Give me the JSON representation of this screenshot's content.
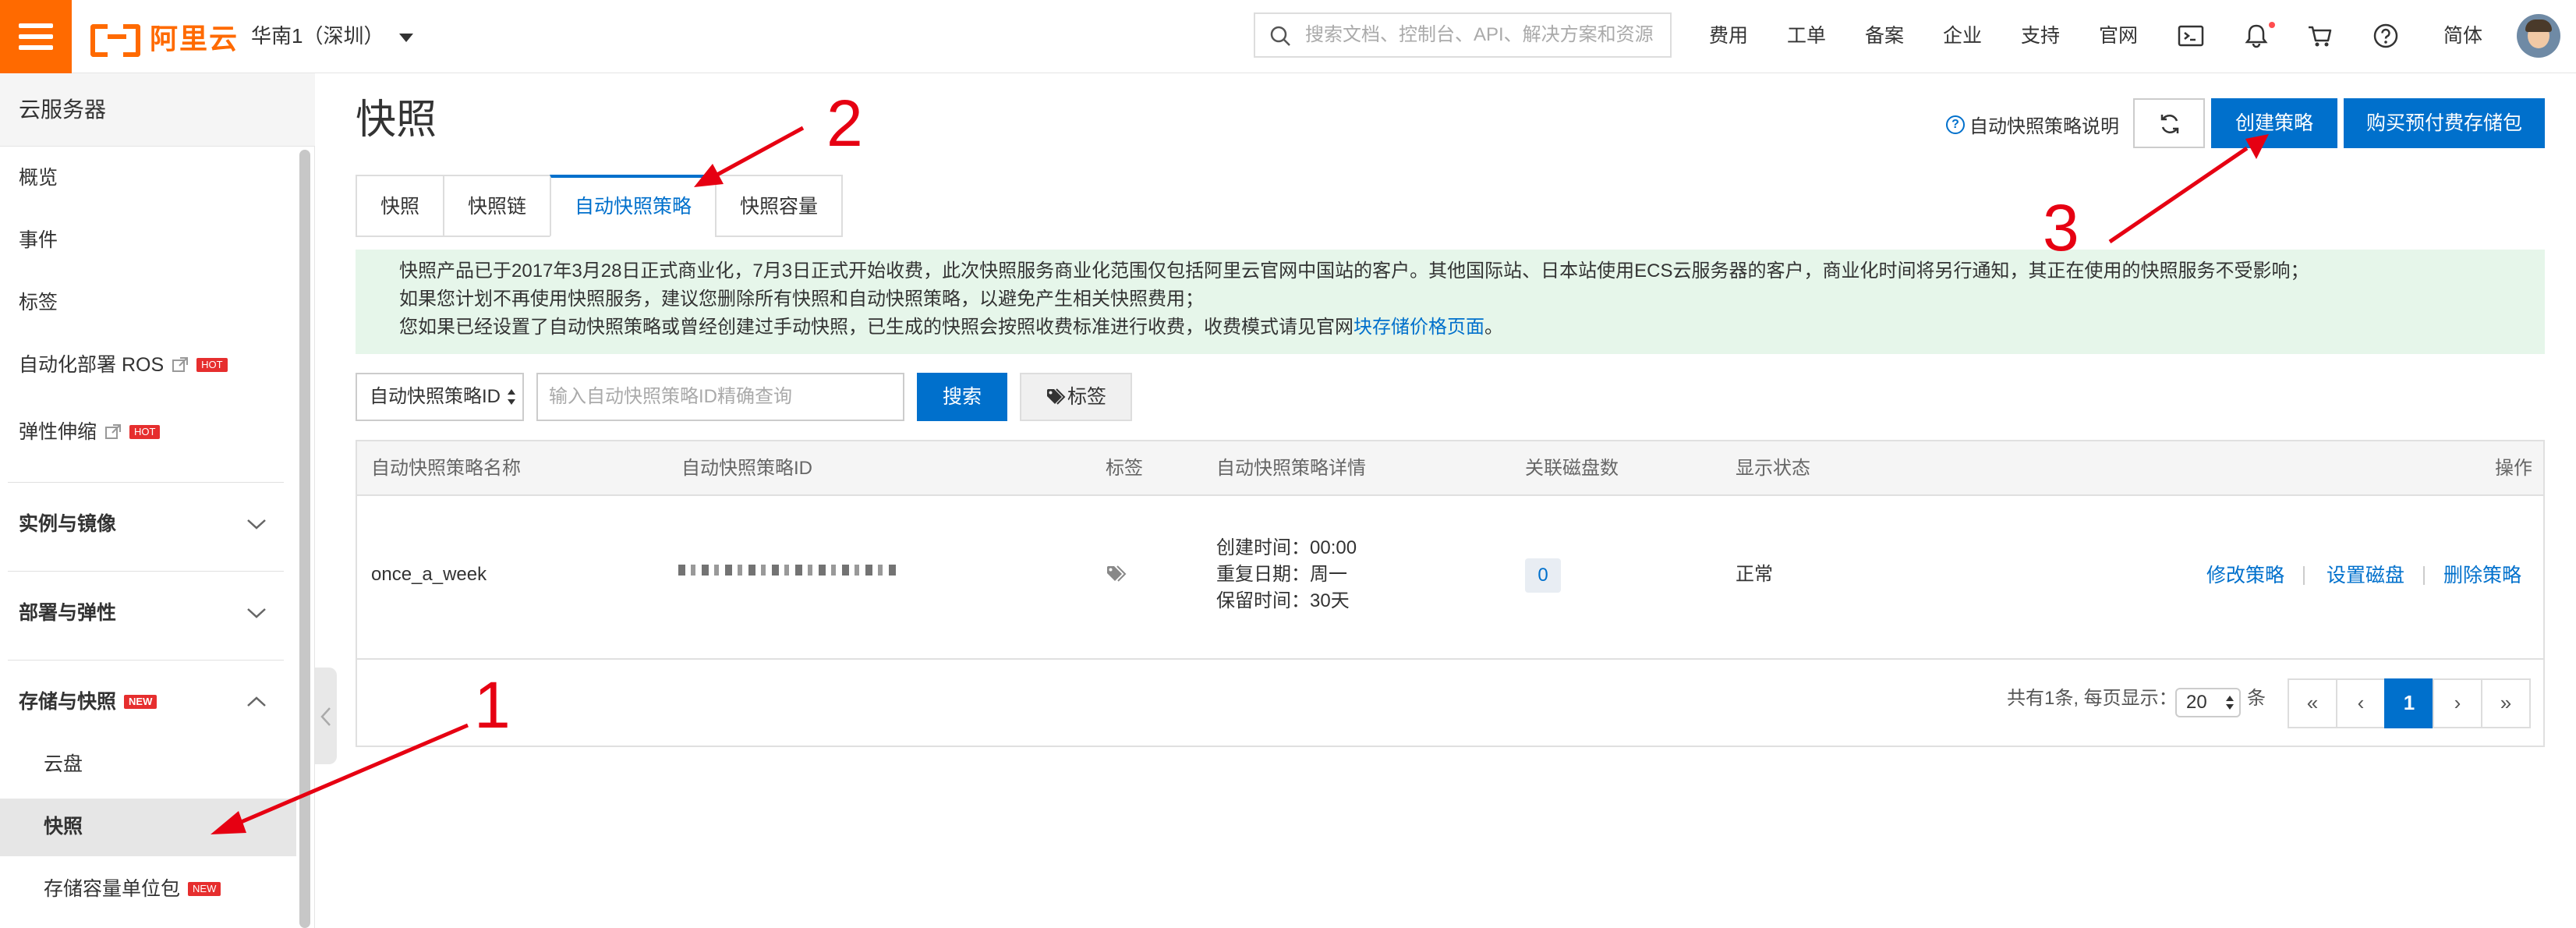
{
  "topbar": {
    "logo_text": "阿里云",
    "region": "华南1（深圳）",
    "search_placeholder": "搜索文档、控制台、API、解决方案和资源",
    "nav": [
      "费用",
      "工单",
      "备案",
      "企业",
      "支持",
      "官网"
    ],
    "language": "简体",
    "icons": [
      "terminal-icon",
      "bell-icon",
      "cart-icon",
      "help-icon"
    ]
  },
  "sidebar": {
    "title": "云服务器",
    "items": [
      {
        "label": "概览"
      },
      {
        "label": "事件"
      },
      {
        "label": "标签"
      },
      {
        "label": "自动化部署 ROS",
        "badge": "HOT"
      },
      {
        "label": "弹性伸缩",
        "badge": "HOT"
      }
    ],
    "groups": [
      {
        "label": "实例与镜像",
        "state": "collapsed"
      },
      {
        "label": "部署与弹性",
        "state": "collapsed"
      },
      {
        "label": "存储与快照",
        "badge": "NEW",
        "state": "expanded"
      }
    ],
    "sub_items": [
      {
        "label": "云盘"
      },
      {
        "label": "快照",
        "active": true
      },
      {
        "label": "存储容量单位包",
        "badge": "NEW"
      }
    ]
  },
  "main": {
    "title": "快照",
    "help_link": "自动快照策略说明",
    "create_button": "创建策略",
    "buy_button": "购买预付费存储包",
    "tabs": [
      {
        "label": "快照",
        "active": false
      },
      {
        "label": "快照链",
        "active": false
      },
      {
        "label": "自动快照策略",
        "active": true
      },
      {
        "label": "快照容量",
        "active": false
      }
    ],
    "notice": {
      "line1": "快照产品已于2017年3月28日正式商业化，7月3日正式开始收费，此次快照服务商业化范围仅包括阿里云官网中国站的客户。其他国际站、日本站使用ECS云服务器的客户，商业化时间将另行通知，其正在使用的快照服务不受影响；",
      "line2": "如果您计划不再使用快照服务，建议您删除所有快照和自动快照策略，以避免产生相关快照费用；",
      "line3_prefix": "您如果已经设置了自动快照策略或曾经创建过手动快照，已生成的快照会按照收费标准进行收费，收费模式请见官网",
      "line3_link": "块存储价格页面",
      "line3_suffix": "。"
    },
    "filter": {
      "select_value": "自动快照策略ID",
      "input_placeholder": "输入自动快照策略ID精确查询",
      "search_button": "搜索",
      "tag_button": "标签"
    },
    "table": {
      "columns": [
        "自动快照策略名称",
        "自动快照策略ID",
        "标签",
        "自动快照策略详情",
        "关联磁盘数",
        "显示状态",
        "操作"
      ],
      "rows": [
        {
          "name": "once_a_week",
          "created_time": "创建时间：00:00",
          "repeat_day": "重复日期：周一",
          "retention": "保留时间：30天",
          "disk_count": "0",
          "status": "正常",
          "actions": [
            "修改策略",
            "设置磁盘",
            "删除策略"
          ]
        }
      ]
    },
    "pagination": {
      "total_text": "共有1条, 每页显示：",
      "page_size": "20",
      "unit": "条",
      "buttons": [
        "«",
        "‹",
        "1",
        "›",
        "»"
      ]
    }
  },
  "annotations": {
    "labels": [
      "1",
      "2",
      "3"
    ],
    "color": "#e60012"
  },
  "colors": {
    "brand": "#ff6a00",
    "primary": "#0070cc",
    "notice_bg": "#e6f6ea",
    "badge": "#e62e2e"
  }
}
